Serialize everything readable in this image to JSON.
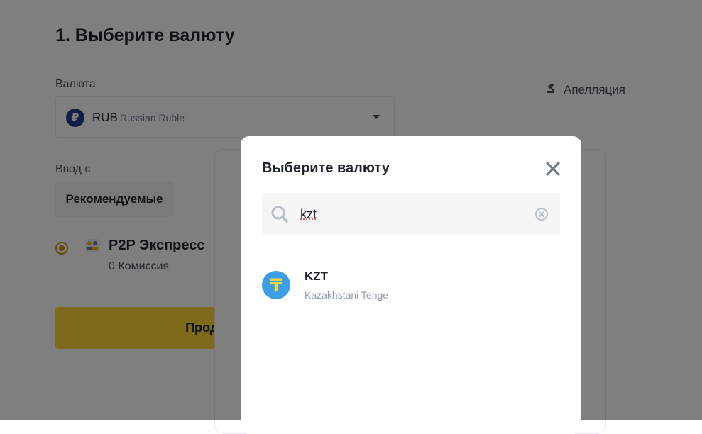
{
  "page": {
    "step_title": "1. Выберите валюту",
    "currency_label": "Валюта",
    "selected_currency": {
      "code": "RUB",
      "name": "Russian Ruble",
      "symbol": "₽"
    },
    "appeal_label": "Апелляция",
    "input_from_label": "Ввод с",
    "recommended_tab": "Рекомендуемые",
    "payment_method": {
      "title": "P2P Экспресс",
      "fee": "0 Комиссия"
    },
    "continue_button": "Продолжить"
  },
  "modal": {
    "title": "Выберите валюту",
    "search": {
      "value": "kzt",
      "placeholder": ""
    },
    "results": [
      {
        "code": "KZT",
        "name": "Kazakhstani Tenge",
        "symbol": "₸"
      }
    ]
  },
  "colors": {
    "accent_yellow": "#fcd535",
    "radio": "#c99400",
    "rub_icon": "#233f8e",
    "kzt_icon_bg": "#3c9fe6",
    "kzt_icon_fg": "#f0d73b"
  },
  "icons": {
    "close": "close-icon",
    "search": "search-icon",
    "clear": "clear-icon",
    "appeal": "gavel-icon",
    "dropdown": "chevron-down-icon"
  }
}
